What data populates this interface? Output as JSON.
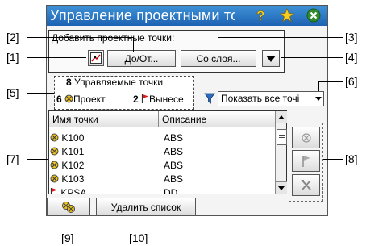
{
  "window": {
    "title": "Управление проектными то",
    "accent_color": "#1d62b3"
  },
  "titlebar_icons": [
    "help-icon",
    "favorite-star-icon",
    "close-icon"
  ],
  "add_group": {
    "label": "Добавить проектные точки:",
    "from_to_button": "До/От...",
    "from_layer_button": "Со слоя..."
  },
  "counts": {
    "managed_count": "8",
    "managed_label": "Управляемые точки",
    "project_count": "6",
    "project_label": "Проект",
    "staked_count": "2",
    "staked_label": "Вынесе"
  },
  "filter": {
    "selected": "Показать все точі"
  },
  "table": {
    "columns": [
      "Имя точки",
      "Описание"
    ],
    "rows": [
      {
        "name": "K100",
        "desc": "ABS"
      },
      {
        "name": "K101",
        "desc": "ABS"
      },
      {
        "name": "K102",
        "desc": "ABS"
      },
      {
        "name": "K103",
        "desc": "ABS"
      },
      {
        "name": "KPSA",
        "desc": "DD"
      }
    ]
  },
  "bottom": {
    "clear_list_button": "Удалить список"
  },
  "callouts": [
    "[1]",
    "[2]",
    "[3]",
    "[4]",
    "[5]",
    "[6]",
    "[7]",
    "[8]",
    "[9]",
    "[10]"
  ]
}
